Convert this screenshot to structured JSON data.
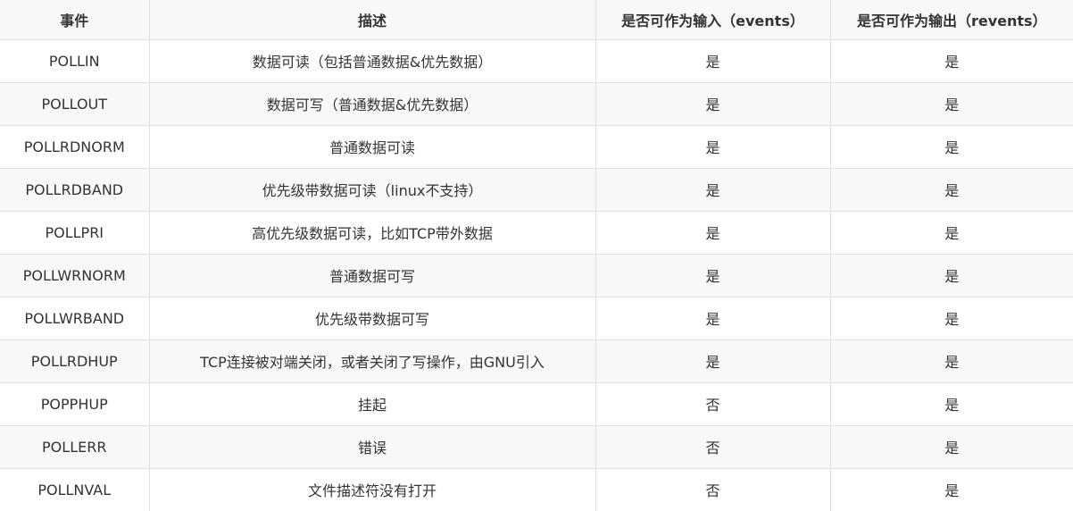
{
  "table": {
    "headers": [
      "事件",
      "描述",
      "是否可作为输入（events）",
      "是否可作为输出（revents）"
    ],
    "rows": [
      [
        "POLLIN",
        "数据可读（包括普通数据&优先数据）",
        "是",
        "是"
      ],
      [
        "POLLOUT",
        "数据可写（普通数据&优先数据）",
        "是",
        "是"
      ],
      [
        "POLLRDNORM",
        "普通数据可读",
        "是",
        "是"
      ],
      [
        "POLLRDBAND",
        "优先级带数据可读（linux不支持）",
        "是",
        "是"
      ],
      [
        "POLLPRI",
        "高优先级数据可读，比如TCP带外数据",
        "是",
        "是"
      ],
      [
        "POLLWRNORM",
        "普通数据可写",
        "是",
        "是"
      ],
      [
        "POLLWRBAND",
        "优先级带数据可写",
        "是",
        "是"
      ],
      [
        "POLLRDHUP",
        "TCP连接被对端关闭，或者关闭了写操作，由GNU引入",
        "是",
        "是"
      ],
      [
        "POPPHUP",
        "挂起",
        "否",
        "是"
      ],
      [
        "POLLERR",
        "错误",
        "否",
        "是"
      ],
      [
        "POLLNVAL",
        "文件描述符没有打开",
        "否",
        "是"
      ]
    ]
  }
}
